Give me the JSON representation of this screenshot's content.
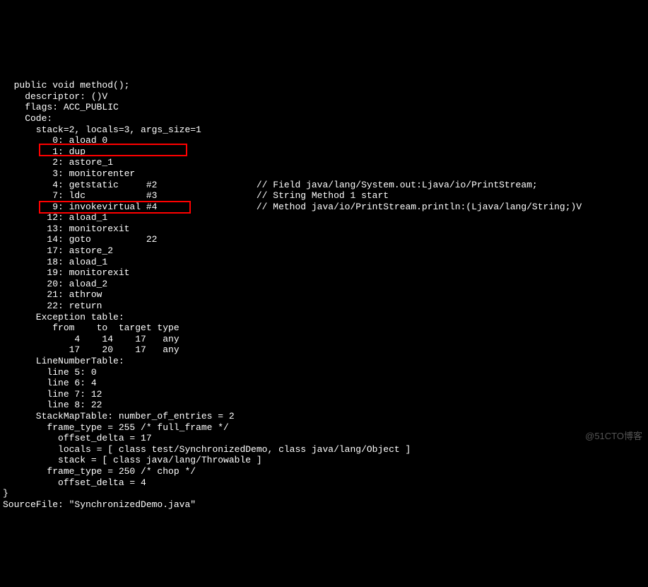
{
  "lines": [
    "  public void method();",
    "    descriptor: ()V",
    "    flags: ACC_PUBLIC",
    "    Code:",
    "      stack=2, locals=3, args_size=1",
    "         0: aload_0",
    "         1: dup",
    "         2: astore_1",
    "         3: monitorenter",
    "         4: getstatic     #2                  // Field java/lang/System.out:Ljava/io/PrintStream;",
    "         7: ldc           #3                  // String Method 1 start",
    "         9: invokevirtual #4                  // Method java/io/PrintStream.println:(Ljava/lang/String;)V",
    "        12: aload_1",
    "        13: monitorexit",
    "        14: goto          22",
    "        17: astore_2",
    "        18: aload_1",
    "        19: monitorexit",
    "        20: aload_2",
    "        21: athrow",
    "        22: return",
    "      Exception table:",
    "         from    to  target type",
    "             4    14    17   any",
    "            17    20    17   any",
    "      LineNumberTable:",
    "        line 5: 0",
    "        line 6: 4",
    "        line 7: 12",
    "        line 8: 22",
    "      StackMapTable: number_of_entries = 2",
    "        frame_type = 255 /* full_frame */",
    "          offset_delta = 17",
    "          locals = [ class test/SynchronizedDemo, class java/lang/Object ]",
    "          stack = [ class java/lang/Throwable ]",
    "        frame_type = 250 /* chop */",
    "          offset_delta = 4",
    "}",
    "SourceFile: \"SynchronizedDemo.java\""
  ],
  "watermark": "@51CTO博客"
}
